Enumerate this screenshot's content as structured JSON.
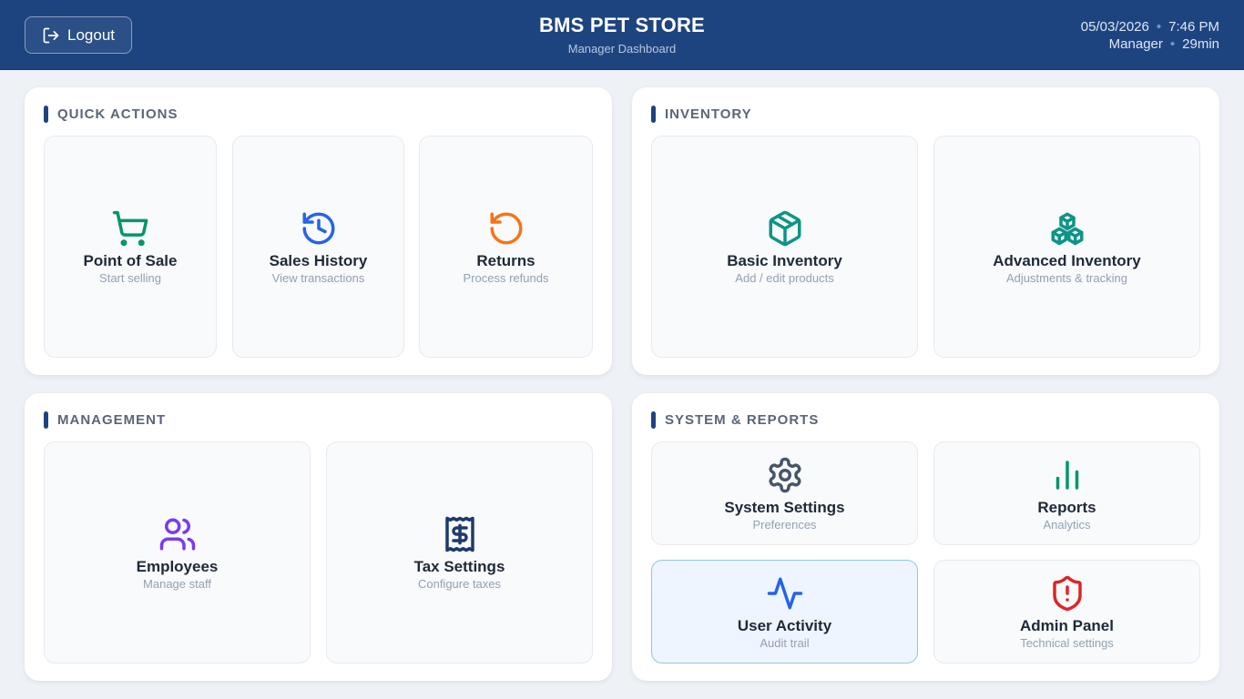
{
  "header": {
    "logout_label": "Logout",
    "title": "BMS PET STORE",
    "subtitle": "Manager Dashboard",
    "date": "05/03/2026",
    "time": "7:46 PM",
    "role": "Manager",
    "session": "29min"
  },
  "sections": {
    "quick_actions": {
      "title": "QUICK ACTIONS",
      "tiles": [
        {
          "title": "Point of Sale",
          "subtitle": "Start selling",
          "icon": "cart-icon",
          "color": "#059669"
        },
        {
          "title": "Sales History",
          "subtitle": "View transactions",
          "icon": "history-icon",
          "color": "#2563eb"
        },
        {
          "title": "Returns",
          "subtitle": "Process refunds",
          "icon": "rotate-ccw-icon",
          "color": "#f97316"
        }
      ]
    },
    "inventory": {
      "title": "INVENTORY",
      "tiles": [
        {
          "title": "Basic Inventory",
          "subtitle": "Add / edit products",
          "icon": "package-icon",
          "color": "#0d9488"
        },
        {
          "title": "Advanced Inventory",
          "subtitle": "Adjustments & tracking",
          "icon": "boxes-icon",
          "color": "#0d9488"
        }
      ]
    },
    "management": {
      "title": "MANAGEMENT",
      "tiles": [
        {
          "title": "Employees",
          "subtitle": "Manage staff",
          "icon": "users-icon",
          "color": "#7c3aed"
        },
        {
          "title": "Tax Settings",
          "subtitle": "Configure taxes",
          "icon": "receipt-dollar-icon",
          "color": "#1e3a6e"
        }
      ]
    },
    "system_reports": {
      "title": "SYSTEM & REPORTS",
      "tiles": [
        {
          "title": "System Settings",
          "subtitle": "Preferences",
          "icon": "gear-icon",
          "color": "#475569"
        },
        {
          "title": "Reports",
          "subtitle": "Analytics",
          "icon": "bar-chart-icon",
          "color": "#059669"
        },
        {
          "title": "User Activity",
          "subtitle": "Audit trail",
          "icon": "activity-icon",
          "color": "#2563eb"
        },
        {
          "title": "Admin Panel",
          "subtitle": "Technical settings",
          "icon": "shield-alert-icon",
          "color": "#dc2626"
        }
      ]
    }
  }
}
